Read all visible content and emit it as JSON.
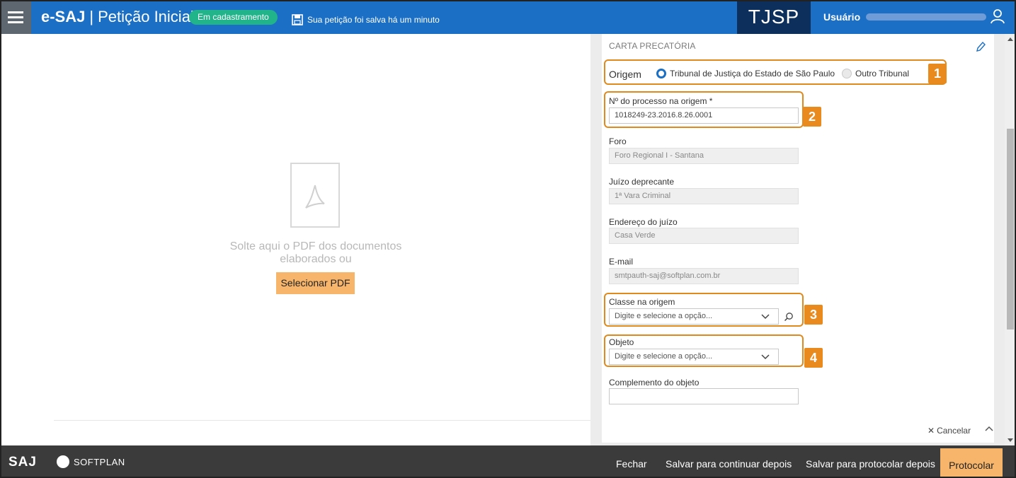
{
  "header": {
    "app_name": "e-SAJ",
    "separator": "|",
    "page_title": "Petição Inicial",
    "status_badge": "Em cadastramento",
    "save_status": "Sua petição foi salva há um minuto",
    "court_logo": "TJSP",
    "user_label": "Usuário",
    "icons": {
      "menu": "menu-icon",
      "save": "floppy-disk-icon",
      "user": "user-icon"
    }
  },
  "dropzone": {
    "instruction": "Solte aqui o PDF dos documentos elaborados ou",
    "select_button": "Selecionar PDF",
    "icon": "pdf-file-icon"
  },
  "form": {
    "section_title": "CARTA PRECATÓRIA",
    "origem": {
      "label": "Origem",
      "options": [
        "Tribunal de Justiça do Estado de São Paulo",
        "Outro Tribunal"
      ],
      "selected": "Tribunal de Justiça do Estado de São Paulo"
    },
    "processo": {
      "label": "Nº do processo na origem *",
      "value": "1018249-23.2016.8.26.0001"
    },
    "foro": {
      "label": "Foro",
      "value": "Foro Regional I - Santana"
    },
    "juizo": {
      "label": "Juízo deprecante",
      "value": "1ª Vara Criminal"
    },
    "endereco": {
      "label": "Endereço do juízo",
      "value": "Casa Verde"
    },
    "email": {
      "label": "E-mail",
      "value": "smtpauth-saj@softplan.com.br"
    },
    "classe": {
      "label": "Classe na origem",
      "placeholder": "Digite e selecione a opção..."
    },
    "objeto": {
      "label": "Objeto",
      "placeholder": "Digite e selecione a opção..."
    },
    "complemento": {
      "label": "Complemento do objeto",
      "value": ""
    },
    "cancel": "Cancelar",
    "callouts": [
      "1",
      "2",
      "3",
      "4"
    ]
  },
  "footer": {
    "logo": "SAJ",
    "brand": "SOFTPLAN",
    "buttons": {
      "close": "Fechar",
      "save_continue": "Salvar para continuar depois",
      "save_protocol": "Salvar para protocolar depois",
      "protocol": "Protocolar"
    }
  },
  "colors": {
    "header_blue": "#1b6fc4",
    "tjsp_navy": "#0c2f5c",
    "status_green": "#21b38a",
    "callout_orange": "#e98a1f",
    "button_orange": "#f6b56a",
    "footer_dark": "#3b3b3b"
  }
}
